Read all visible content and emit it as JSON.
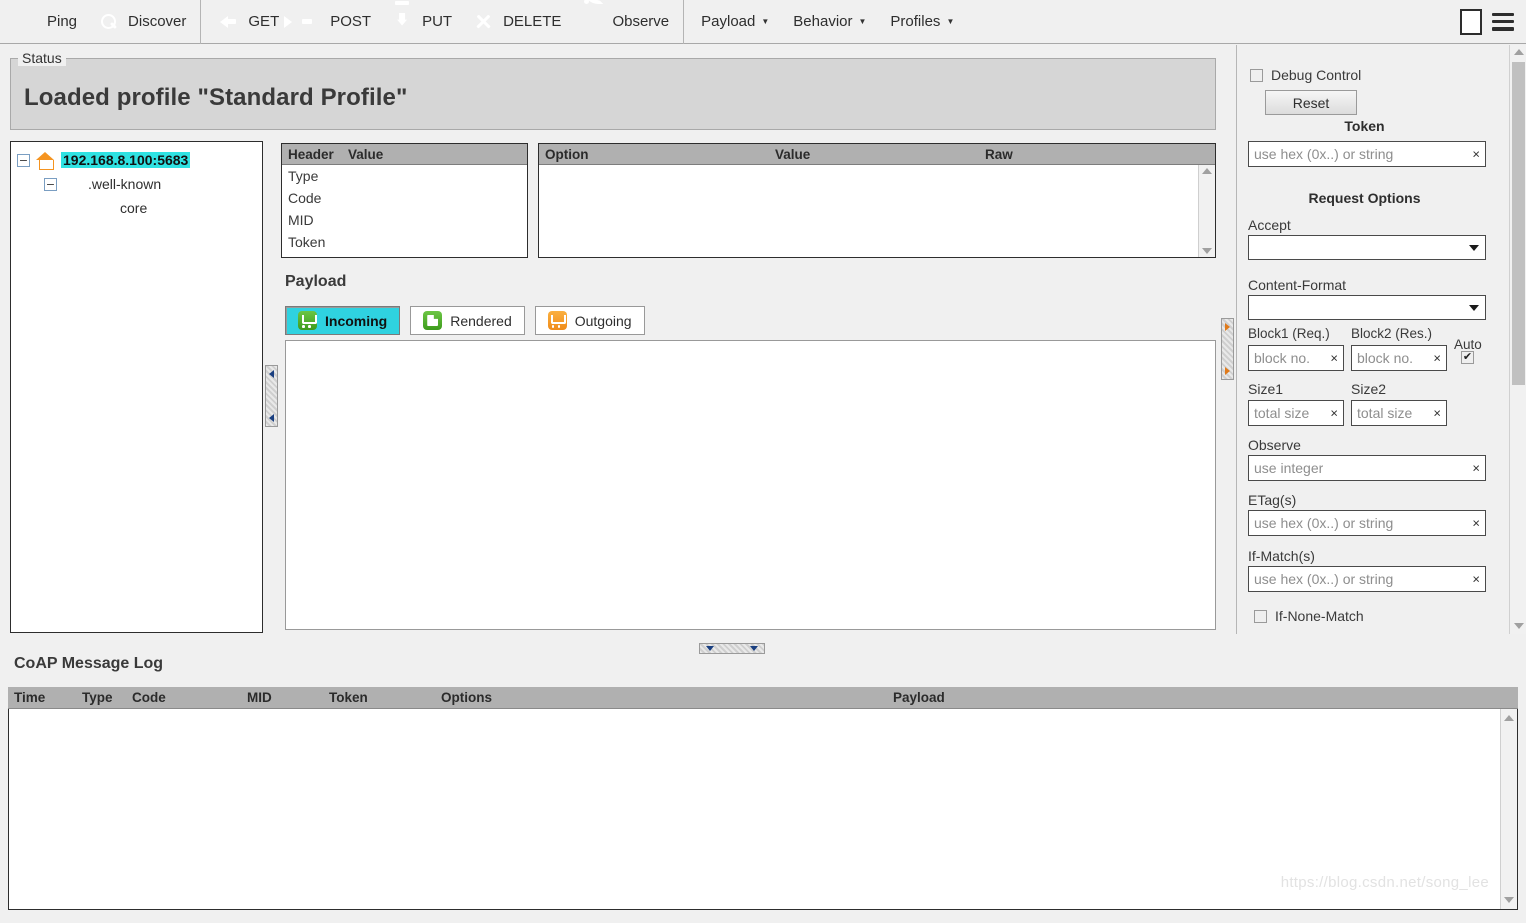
{
  "toolbar": {
    "actions": [
      {
        "label": "Ping",
        "icon": "ping-icon"
      },
      {
        "label": "Discover",
        "icon": "discover-icon"
      },
      {
        "label": "GET",
        "icon": "get-icon"
      },
      {
        "label": "POST",
        "icon": "post-icon"
      },
      {
        "label": "PUT",
        "icon": "put-icon"
      },
      {
        "label": "DELETE",
        "icon": "delete-icon"
      },
      {
        "label": "Observe",
        "icon": "observe-icon"
      }
    ],
    "menus": [
      {
        "label": "Payload",
        "icon": "chevron-down-icon"
      },
      {
        "label": "Behavior",
        "icon": "chevron-down-icon"
      },
      {
        "label": "Profiles",
        "icon": "chevron-down-icon"
      }
    ],
    "window_button": "maximize-icon",
    "menu_button": "hamburger-menu-icon"
  },
  "status": {
    "legend": "Status",
    "message": "Loaded profile \"Standard Profile\""
  },
  "tree": {
    "root": {
      "label": "192.168.8.100:5683",
      "icon": "home-icon",
      "toggle": "−",
      "selected": true
    },
    "child": {
      "label": ".well-known",
      "icon": "globe-icon",
      "toggle": "−"
    },
    "leaf": {
      "label": "core",
      "icon": "core-search-icon"
    }
  },
  "header_table": {
    "columns": [
      "Header",
      "Value"
    ],
    "rows": [
      "Type",
      "Code",
      "MID",
      "Token"
    ]
  },
  "options_table": {
    "columns": [
      "Option",
      "Value",
      "Raw"
    ],
    "rows": []
  },
  "payload": {
    "title": "Payload",
    "tabs": [
      {
        "label": "Incoming",
        "icon": "incoming-icon",
        "active": true
      },
      {
        "label": "Rendered",
        "icon": "rendered-icon",
        "active": false
      },
      {
        "label": "Outgoing",
        "icon": "outgoing-icon",
        "active": false
      }
    ],
    "content": ""
  },
  "right_panel": {
    "debug_control": {
      "label": "Debug Control",
      "checked": false
    },
    "reset_button": "Reset",
    "token_heading": "Token",
    "token_placeholder": "use hex (0x..) or string",
    "request_options_heading": "Request Options",
    "accept": {
      "label": "Accept",
      "value": ""
    },
    "content_format": {
      "label": "Content-Format",
      "value": ""
    },
    "block1": {
      "label": "Block1 (Req.)",
      "placeholder": "block no."
    },
    "block2": {
      "label": "Block2 (Res.)",
      "placeholder": "block no."
    },
    "auto": {
      "label": "Auto",
      "checked": true,
      "mark": "✔"
    },
    "size1": {
      "label": "Size1",
      "placeholder": "total size"
    },
    "size2": {
      "label": "Size2",
      "placeholder": "total size"
    },
    "observe": {
      "label": "Observe",
      "placeholder": "use integer"
    },
    "etag": {
      "label": "ETag(s)",
      "placeholder": "use hex (0x..) or string"
    },
    "if_match": {
      "label": "If-Match(s)",
      "placeholder": "use hex (0x..) or string"
    },
    "if_none_match": {
      "label": "If-None-Match",
      "checked": false
    },
    "clear_glyph": "×"
  },
  "log": {
    "title": "CoAP Message Log",
    "columns": [
      "Time",
      "Type",
      "Code",
      "MID",
      "Token",
      "Options",
      "Payload"
    ],
    "rows": []
  },
  "watermark": "https://blog.csdn.net/song_lee",
  "colors": {
    "selection": "#2fe2e2",
    "active_tab": "#2fd2e0",
    "table_header": "#b0b0b0",
    "status_bg": "#d6d6d6",
    "chrome": "#f0f0f0"
  }
}
